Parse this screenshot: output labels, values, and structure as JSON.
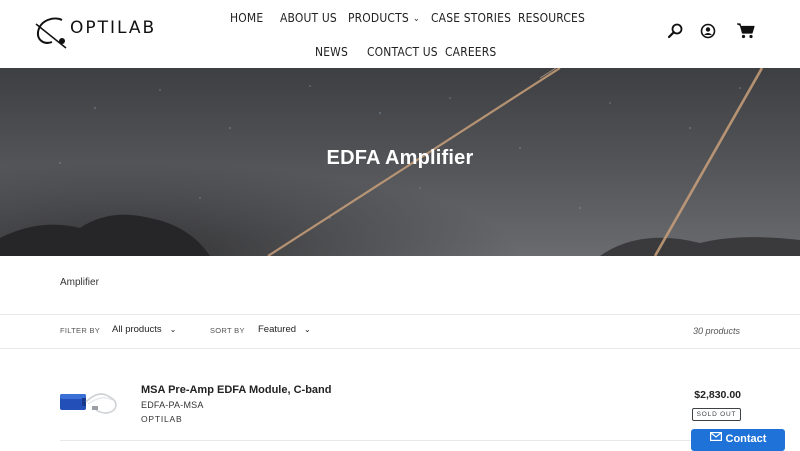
{
  "header": {
    "logo_text": "OPTILAB",
    "nav": {
      "home": "HOME",
      "about": "ABOUT US",
      "products": "PRODUCTS",
      "case_stories": "CASE STORIES",
      "resources": "RESOURCES",
      "news": "NEWS",
      "contact": "CONTACT US",
      "careers": "CAREERS"
    },
    "icons": [
      "search-icon",
      "account-icon",
      "cart-icon"
    ]
  },
  "hero": {
    "title": "EDFA Amplifier"
  },
  "collection": {
    "description": "Amplifier"
  },
  "filters": {
    "filter_label": "FILTER BY",
    "filter_value": "All products",
    "sort_label": "SORT BY",
    "sort_value": "Featured",
    "product_count": "30 products"
  },
  "products": [
    {
      "title": "MSA Pre-Amp EDFA Module, C-band",
      "sku": "EDFA-PA-MSA",
      "vendor": "OPTILAB",
      "price": "$2,830.00",
      "badge": "SOLD OUT"
    }
  ],
  "contact_button": {
    "label": "Contact",
    "color": "#1f73d8"
  }
}
